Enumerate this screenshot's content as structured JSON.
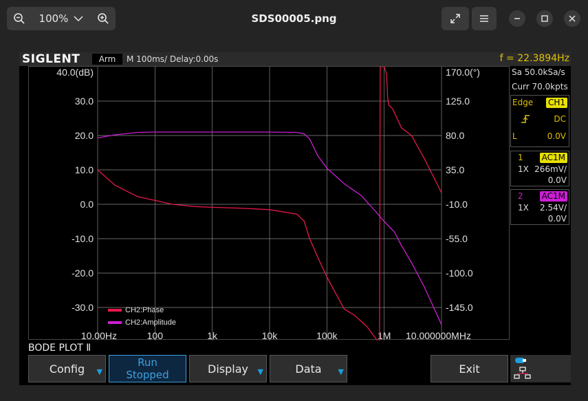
{
  "viewer": {
    "zoom": "100%",
    "file_title": "SDS00005.png"
  },
  "scope": {
    "brand": "SIGLENT",
    "trigger_state": "Arm",
    "timebase": "M 100ms/  Delay:0.00s",
    "frequency": "f = 22.3894Hz",
    "sample_rate": "Sa 50.0kSa/s",
    "memory": "Curr 70.0kpts",
    "trigger": {
      "type": "Edge",
      "source": "CH1",
      "coupling": "DC",
      "level_label": "L",
      "level": "0.0V"
    },
    "ch1": {
      "num": "1",
      "coupling": "AC1M",
      "probe": "1X",
      "scale": "266mV/",
      "offset": "0.0V"
    },
    "ch2": {
      "num": "2",
      "coupling": "AC1M",
      "probe": "1X",
      "scale": "2.54V/",
      "offset": "0.0V"
    },
    "mode_title": "BODE PLOT Ⅱ",
    "softkeys": {
      "config": "Config",
      "run_line1": "Run",
      "run_line2": "Stopped",
      "display": "Display",
      "data": "Data",
      "exit": "Exit"
    }
  },
  "colors": {
    "phase": "#e8194a",
    "amplitude": "#cc1fd6",
    "grid": "#8a8a8a",
    "accent": "#1a9ee0",
    "ch1_tag": "#e8e000",
    "ch2_tag": "#cc1fd6",
    "freq_text": "#e0c000"
  },
  "chart_data": {
    "type": "line",
    "xlabel": "",
    "ylabel": "",
    "x_scale": "log",
    "xlim": [
      10,
      10000000
    ],
    "x_ticks": [
      "10.00Hz",
      "100",
      "1k",
      "10k",
      "100k",
      "1M",
      "10.000000MHz"
    ],
    "ylim_left": [
      -35,
      40
    ],
    "y_left_ticks": [
      "40.0(dB)",
      "30.0",
      "20.0",
      "10.0",
      "0.0",
      "-10.0",
      "-20.0",
      "-30.0"
    ],
    "ylim_right": [
      -190,
      170
    ],
    "y_right_ticks": [
      "170.0(°)",
      "125.0",
      "80.0",
      "35.0",
      "-10.0",
      "-55.0",
      "-100.0",
      "-145.0"
    ],
    "grid": true,
    "legend_position": "bottom-left",
    "series": [
      {
        "name": "CH2:Phase",
        "axis": "right",
        "unit": "deg",
        "x": [
          10,
          20,
          50,
          100,
          200,
          500,
          1000,
          3000,
          10000,
          30000,
          40000,
          50000,
          70000,
          100000,
          200000,
          300000,
          500000,
          700000,
          800000,
          830000,
          850000,
          1000000,
          1100000,
          1150000,
          1200000,
          1400000,
          2000000,
          3000000,
          5000000,
          10000000
        ],
        "values": [
          35,
          15,
          0,
          -5,
          -10,
          -13,
          -14,
          -15,
          -17,
          -23,
          -32,
          -55,
          -80,
          -105,
          -147,
          -155,
          -170,
          -185,
          -190,
          -190,
          170,
          170,
          160,
          130,
          120,
          115,
          90,
          80,
          50,
          5
        ]
      },
      {
        "name": "CH2:Amplitude",
        "axis": "left",
        "unit": "dB",
        "x": [
          10,
          20,
          30,
          50,
          100,
          200,
          1000,
          10000,
          30000,
          40000,
          50000,
          70000,
          100000,
          200000,
          400000,
          700000,
          1000000,
          1500000,
          2000000,
          3000000,
          5000000,
          10000000
        ],
        "values": [
          19.3,
          20.2,
          20.5,
          20.9,
          21.0,
          21.0,
          21.0,
          21.0,
          20.9,
          20.5,
          19,
          14,
          10.5,
          6,
          2.5,
          -2,
          -5,
          -8,
          -12,
          -17,
          -24,
          -35
        ]
      }
    ]
  }
}
